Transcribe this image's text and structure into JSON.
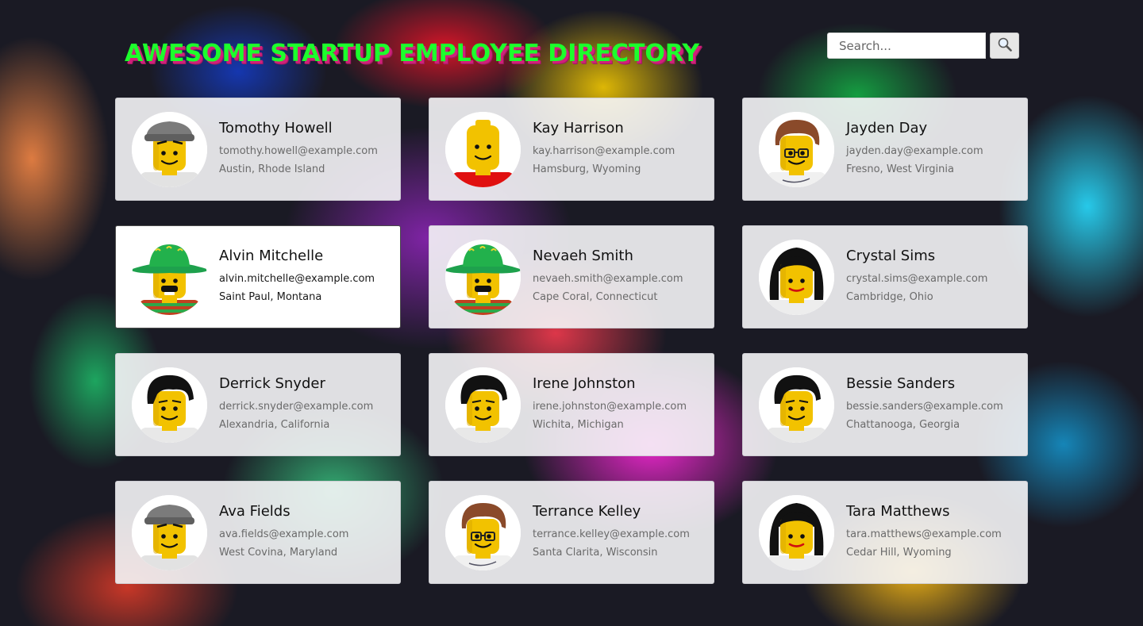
{
  "header": {
    "title": "AWESOME STARTUP EMPLOYEE DIRECTORY",
    "title_color": "#1cff2c",
    "title_shadow_color": "#d0207a"
  },
  "search": {
    "placeholder": "Search...",
    "value": "",
    "button_icon": "magnifying-glass-icon"
  },
  "employees": [
    {
      "name": "Tomothy Howell",
      "email": "tomothy.howell@example.com",
      "location": "Austin, Rhode Island",
      "avatar": "lego-gray-cap-icon",
      "active": false
    },
    {
      "name": "Kay Harrison",
      "email": "kay.harrison@example.com",
      "location": "Hamsburg, Wyoming",
      "avatar": "lego-bald-red-shirt-icon",
      "active": false
    },
    {
      "name": "Jayden Day",
      "email": "jayden.day@example.com",
      "location": "Fresno, West Virginia",
      "avatar": "lego-brown-hair-glasses-icon",
      "active": false
    },
    {
      "name": "Alvin Mitchelle",
      "email": "alvin.mitchelle@example.com",
      "location": "Saint Paul, Montana",
      "avatar": "lego-sombrero-mustache-icon",
      "active": true
    },
    {
      "name": "Nevaeh Smith",
      "email": "nevaeh.smith@example.com",
      "location": "Cape Coral, Connecticut",
      "avatar": "lego-sombrero-mustache-icon",
      "active": false
    },
    {
      "name": "Crystal Sims",
      "email": "crystal.sims@example.com",
      "location": "Cambridge, Ohio",
      "avatar": "lego-long-black-hair-icon",
      "active": false
    },
    {
      "name": "Derrick Snyder",
      "email": "derrick.snyder@example.com",
      "location": "Alexandria, California",
      "avatar": "lego-black-hair-icon",
      "active": false
    },
    {
      "name": "Irene Johnston",
      "email": "irene.johnston@example.com",
      "location": "Wichita, Michigan",
      "avatar": "lego-black-hair-icon",
      "active": false
    },
    {
      "name": "Bessie Sanders",
      "email": "bessie.sanders@example.com",
      "location": "Chattanooga, Georgia",
      "avatar": "lego-black-hair-icon",
      "active": false
    },
    {
      "name": "Ava Fields",
      "email": "ava.fields@example.com",
      "location": "West Covina, Maryland",
      "avatar": "lego-gray-cap-icon",
      "active": false
    },
    {
      "name": "Terrance Kelley",
      "email": "terrance.kelley@example.com",
      "location": "Santa Clarita, Wisconsin",
      "avatar": "lego-brown-hair-glasses-icon",
      "active": false
    },
    {
      "name": "Tara Matthews",
      "email": "tara.matthews@example.com",
      "location": "Cedar Hill, Wyoming",
      "avatar": "lego-long-black-hair-icon",
      "active": false
    }
  ]
}
